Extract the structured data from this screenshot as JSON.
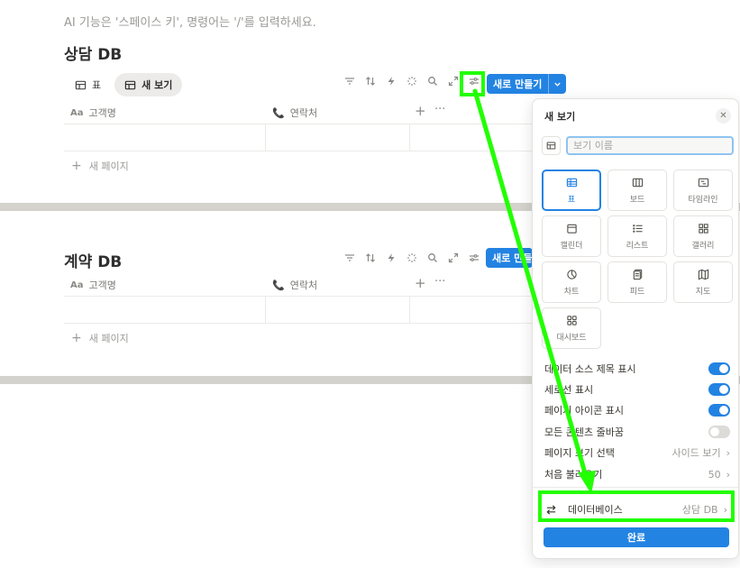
{
  "hint": "AI 기능은 '스페이스 키', 명령어는 '/'를 입력하세요.",
  "databases": [
    {
      "title": "상담 DB",
      "tabs": [
        {
          "label": "표",
          "active": false
        },
        {
          "label": "새 보기",
          "active": true
        }
      ],
      "new_button": "새로 만들기",
      "columns": [
        {
          "label": "고객명",
          "icon": "aa-text-icon"
        },
        {
          "label": "연락처",
          "icon": "phone-icon"
        }
      ],
      "add_page": "새 페이지"
    },
    {
      "title": "계약 DB",
      "new_button": "새로 만들",
      "columns": [
        {
          "label": "고객명",
          "icon": "aa-text-icon"
        },
        {
          "label": "연락처",
          "icon": "phone-icon"
        }
      ],
      "add_page": "새 페이지"
    }
  ],
  "column_type_prefix": "Aa",
  "panel": {
    "title": "새 보기",
    "name_placeholder": "보기 이름",
    "layouts": [
      {
        "label": "표",
        "icon": "table-icon",
        "selected": true
      },
      {
        "label": "보드",
        "icon": "board-icon",
        "selected": false
      },
      {
        "label": "타임라인",
        "icon": "timeline-icon",
        "selected": false
      },
      {
        "label": "캘린더",
        "icon": "calendar-icon",
        "selected": false
      },
      {
        "label": "리스트",
        "icon": "list-icon",
        "selected": false
      },
      {
        "label": "갤러리",
        "icon": "gallery-icon",
        "selected": false
      },
      {
        "label": "차트",
        "icon": "chart-icon",
        "selected": false
      },
      {
        "label": "피드",
        "icon": "feed-icon",
        "selected": false
      },
      {
        "label": "지도",
        "icon": "map-icon",
        "selected": false
      },
      {
        "label": "대시보드",
        "icon": "dashboard-icon",
        "selected": false
      }
    ],
    "toggles": [
      {
        "label": "데이터 소스 제목 표시",
        "on": true
      },
      {
        "label": "세로선 표시",
        "on": true
      },
      {
        "label": "페이지 아이콘 표시",
        "on": true
      },
      {
        "label": "모든 콘텐츠 줄바꿈",
        "on": false
      }
    ],
    "options": [
      {
        "label": "페이지 보기 선택",
        "value": "사이드 보기"
      },
      {
        "label": "처음 불러오기",
        "value": "50"
      }
    ],
    "database_row": {
      "label": "데이터베이스",
      "value": "상담 DB"
    },
    "done_label": "완료"
  },
  "colors": {
    "accent": "#2383e2",
    "highlight": "#22ff00"
  }
}
